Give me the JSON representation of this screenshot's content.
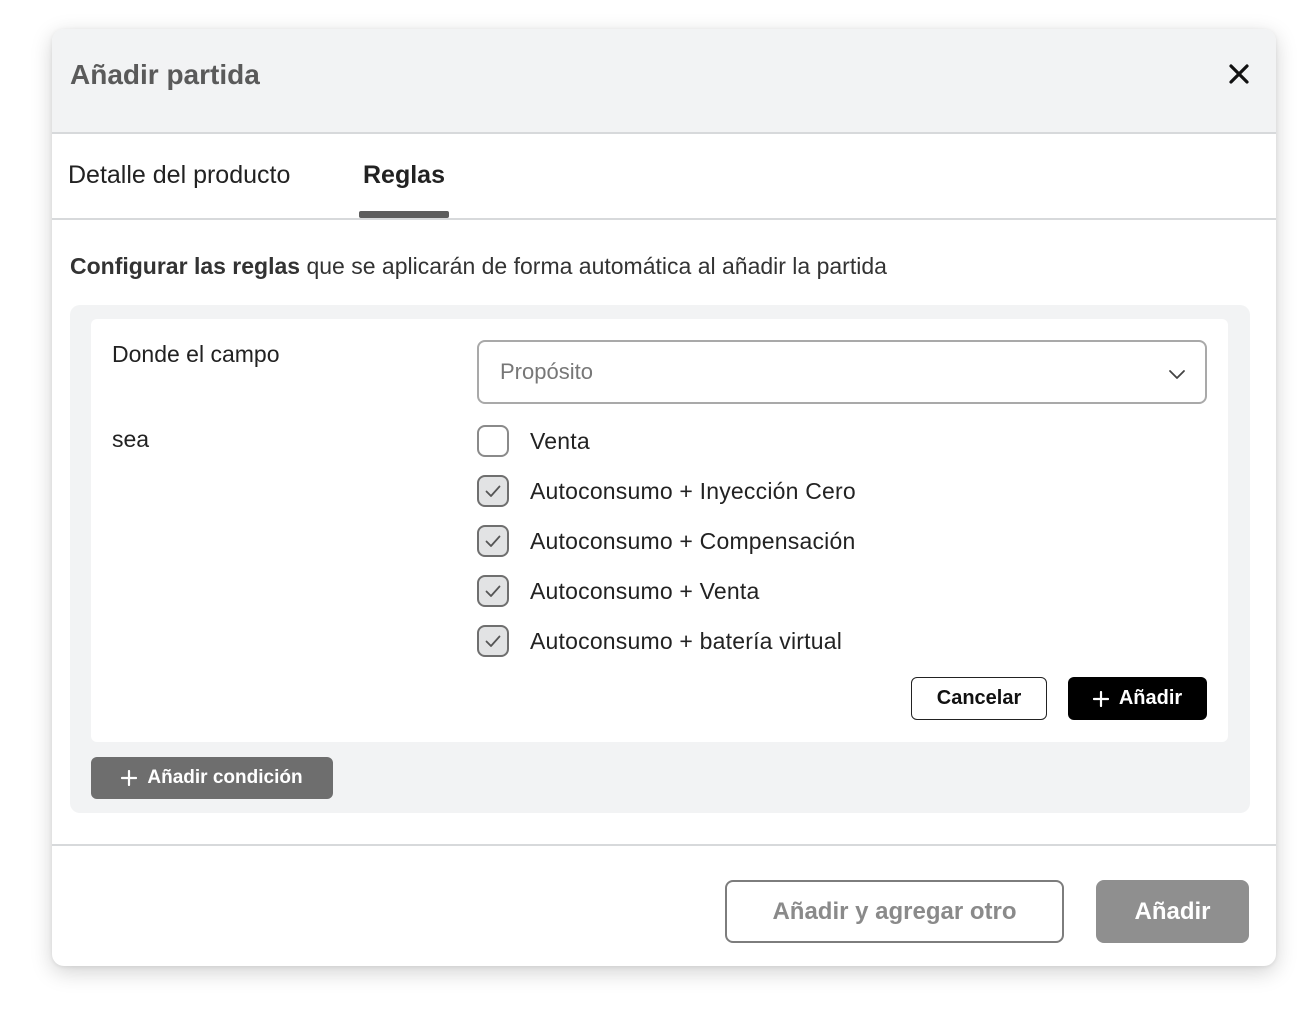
{
  "modal": {
    "title": "Añadir partida"
  },
  "tabs": [
    {
      "label": "Detalle del producto",
      "active": false
    },
    {
      "label": "Reglas",
      "active": true
    }
  ],
  "intro": {
    "bold": "Configurar las reglas",
    "rest": " que se aplicarán de forma automática al añadir la partida"
  },
  "condition": {
    "field_label": "Donde el campo",
    "field_value": "Propósito",
    "operator_label": "sea",
    "options": [
      {
        "label": "Venta",
        "checked": false
      },
      {
        "label": "Autoconsumo + Inyección Cero",
        "checked": true
      },
      {
        "label": "Autoconsumo + Compensación",
        "checked": true
      },
      {
        "label": "Autoconsumo + Venta",
        "checked": true
      },
      {
        "label": "Autoconsumo + batería virtual",
        "checked": true
      }
    ],
    "cancel_label": "Cancelar",
    "add_label": "Añadir"
  },
  "add_condition_label": "Añadir condición",
  "footer": {
    "add_another_label": "Añadir y agregar otro",
    "add_label": "Añadir"
  },
  "icons": {
    "close": "close-icon",
    "chevron": "chevron-down-icon",
    "plus": "plus-icon",
    "check": "check-icon"
  },
  "colors": {
    "header_bg": "#f2f3f4",
    "primary_button": "#000000",
    "disabled_button": "#8f8f8f",
    "secondary_button": "#6e6e6e"
  }
}
